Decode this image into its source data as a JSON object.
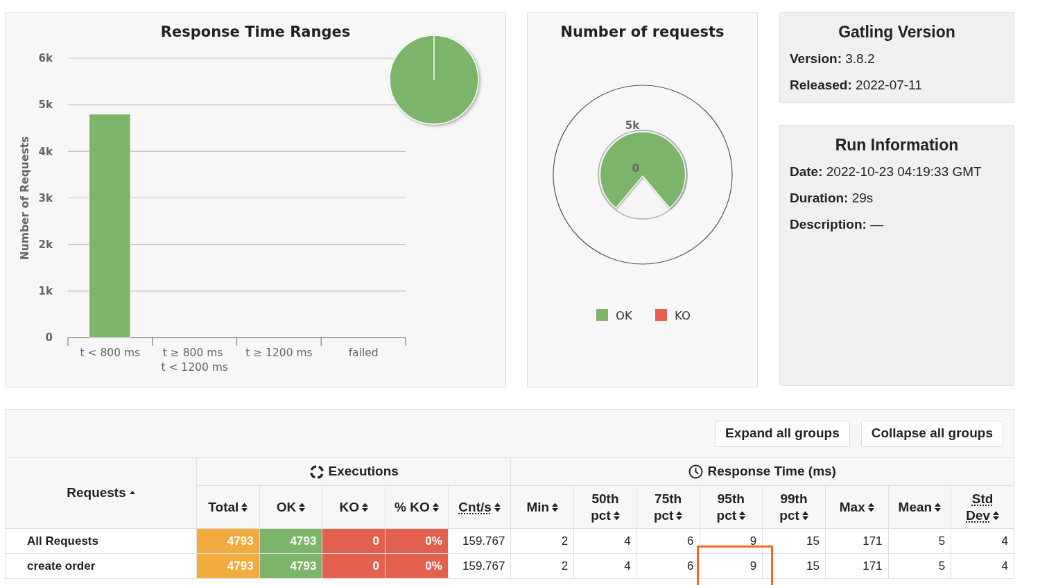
{
  "response_time_ranges": {
    "chart_data": [
      {
        "type": "bar",
        "title": "Response Time Ranges",
        "ylabel": "Number of Requests",
        "categories": [
          "t < 800 ms",
          "t ≥ 800 ms t < 1200 ms",
          "t ≥ 1200 ms",
          "failed"
        ],
        "values": [
          4800,
          0,
          0,
          0
        ],
        "color": "#7cb469",
        "ylim": [
          0,
          6000
        ],
        "yticks": [
          {
            "value": 0,
            "label": "0"
          },
          {
            "value": 1000,
            "label": "1k"
          },
          {
            "value": 2000,
            "label": "2k"
          },
          {
            "value": 3000,
            "label": "3k"
          },
          {
            "value": 4000,
            "label": "4k"
          },
          {
            "value": 5000,
            "label": "5k"
          },
          {
            "value": 6000,
            "label": "6k"
          }
        ],
        "grid": true
      }
    ]
  },
  "number_of_requests": {
    "title": "Number of requests",
    "scale_labels": [
      "5k",
      "0"
    ],
    "legend": [
      {
        "label": "OK",
        "color": "#7cb469"
      },
      {
        "label": "KO",
        "color": "#e4604e"
      }
    ]
  },
  "gatling_version": {
    "title": "Gatling Version",
    "fields": [
      {
        "label": "Version:",
        "value": "3.8.2"
      },
      {
        "label": "Released:",
        "value": "2022-07-11"
      }
    ]
  },
  "run_information": {
    "title": "Run Information",
    "fields": [
      {
        "label": "Date:",
        "value": "2022-10-23 04:19:33 GMT"
      },
      {
        "label": "Duration:",
        "value": "29s"
      },
      {
        "label": "Description:",
        "value": "—"
      }
    ]
  },
  "statistics": {
    "buttons": [
      "Expand all groups",
      "Collapse all groups"
    ],
    "requests_column": {
      "label": "Requests",
      "sorted": true
    },
    "groups": [
      {
        "label": "Executions",
        "kind": "executions",
        "columns": [
          {
            "label": "Total",
            "kind": "total",
            "sorted": false,
            "abbreviation": false
          },
          {
            "label": "OK",
            "kind": "ok",
            "sorted": false,
            "abbreviation": false
          },
          {
            "label": "KO",
            "kind": "ko",
            "sorted": false,
            "abbreviation": false
          },
          {
            "label": "% KO",
            "kind": "ko",
            "sorted": false,
            "abbreviation": false
          },
          {
            "label": "Cnt/s",
            "kind": "number",
            "sorted": false,
            "abbreviation": true
          }
        ]
      },
      {
        "label": "Response Time (ms)",
        "kind": "response_time",
        "columns": [
          {
            "label": "Min",
            "kind": "number",
            "sorted": false,
            "abbreviation": false
          },
          {
            "label": "50th pct",
            "kind": "number",
            "sorted": false,
            "abbreviation": false
          },
          {
            "label": "75th pct",
            "kind": "number",
            "sorted": false,
            "abbreviation": false
          },
          {
            "label": "95th pct",
            "kind": "number",
            "sorted": false,
            "abbreviation": false
          },
          {
            "label": "99th pct",
            "kind": "number",
            "sorted": false,
            "abbreviation": false
          },
          {
            "label": "Max",
            "kind": "number",
            "sorted": false,
            "abbreviation": false
          },
          {
            "label": "Mean",
            "kind": "number",
            "sorted": false,
            "abbreviation": false
          },
          {
            "label": "Std Dev",
            "kind": "number",
            "sorted": false,
            "abbreviation": true
          }
        ]
      }
    ],
    "rows": [
      {
        "name": "All Requests",
        "cells": [
          {
            "value": "4793",
            "highlighted": false
          },
          {
            "value": "4793",
            "highlighted": false
          },
          {
            "value": "0",
            "highlighted": false
          },
          {
            "value": "0%",
            "highlighted": false
          },
          {
            "value": "159.767",
            "highlighted": false
          },
          {
            "value": "2",
            "highlighted": false
          },
          {
            "value": "4",
            "highlighted": false
          },
          {
            "value": "6",
            "highlighted": false
          },
          {
            "value": "9",
            "highlighted": false
          },
          {
            "value": "15",
            "highlighted": false
          },
          {
            "value": "171",
            "highlighted": false
          },
          {
            "value": "5",
            "highlighted": false
          },
          {
            "value": "4",
            "highlighted": false
          }
        ]
      },
      {
        "name": "create order",
        "cells": [
          {
            "value": "4793",
            "highlighted": false
          },
          {
            "value": "4793",
            "highlighted": false
          },
          {
            "value": "0",
            "highlighted": false
          },
          {
            "value": "0%",
            "highlighted": false
          },
          {
            "value": "159.767",
            "highlighted": false
          },
          {
            "value": "2",
            "highlighted": false
          },
          {
            "value": "4",
            "highlighted": false
          },
          {
            "value": "6",
            "highlighted": false
          },
          {
            "value": "9",
            "highlighted": true
          },
          {
            "value": "15",
            "highlighted": false
          },
          {
            "value": "171",
            "highlighted": false
          },
          {
            "value": "5",
            "highlighted": false
          },
          {
            "value": "4",
            "highlighted": false
          }
        ]
      }
    ]
  }
}
